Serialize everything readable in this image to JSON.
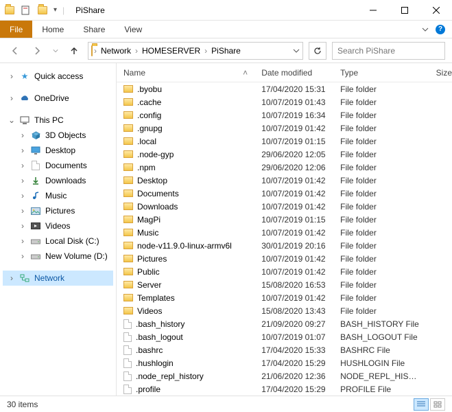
{
  "window": {
    "title": "PiShare"
  },
  "ribbon": {
    "file": "File",
    "home": "Home",
    "share": "Share",
    "view": "View"
  },
  "breadcrumb": {
    "segments": [
      "Network",
      "HOMESERVER",
      "PiShare"
    ]
  },
  "search": {
    "placeholder": "Search PiShare"
  },
  "tree": {
    "quick_access": "Quick access",
    "onedrive": "OneDrive",
    "this_pc": "This PC",
    "children": {
      "objects3d": "3D Objects",
      "desktop": "Desktop",
      "documents": "Documents",
      "downloads": "Downloads",
      "music": "Music",
      "pictures": "Pictures",
      "videos": "Videos",
      "localdisk": "Local Disk (C:)",
      "newvolume": "New Volume (D:)"
    },
    "network": "Network"
  },
  "columns": {
    "name": "Name",
    "date": "Date modified",
    "type": "Type",
    "size": "Size"
  },
  "items": [
    {
      "kind": "folder",
      "name": ".byobu",
      "date": "17/04/2020 15:31",
      "type": "File folder"
    },
    {
      "kind": "folder",
      "name": ".cache",
      "date": "10/07/2019 01:43",
      "type": "File folder"
    },
    {
      "kind": "folder",
      "name": ".config",
      "date": "10/07/2019 16:34",
      "type": "File folder"
    },
    {
      "kind": "folder",
      "name": ".gnupg",
      "date": "10/07/2019 01:42",
      "type": "File folder"
    },
    {
      "kind": "folder",
      "name": ".local",
      "date": "10/07/2019 01:15",
      "type": "File folder"
    },
    {
      "kind": "folder",
      "name": ".node-gyp",
      "date": "29/06/2020 12:05",
      "type": "File folder"
    },
    {
      "kind": "folder",
      "name": ".npm",
      "date": "29/06/2020 12:06",
      "type": "File folder"
    },
    {
      "kind": "folder",
      "name": "Desktop",
      "date": "10/07/2019 01:42",
      "type": "File folder"
    },
    {
      "kind": "folder",
      "name": "Documents",
      "date": "10/07/2019 01:42",
      "type": "File folder"
    },
    {
      "kind": "folder",
      "name": "Downloads",
      "date": "10/07/2019 01:42",
      "type": "File folder"
    },
    {
      "kind": "folder",
      "name": "MagPi",
      "date": "10/07/2019 01:15",
      "type": "File folder"
    },
    {
      "kind": "folder",
      "name": "Music",
      "date": "10/07/2019 01:42",
      "type": "File folder"
    },
    {
      "kind": "folder",
      "name": "node-v11.9.0-linux-armv6l",
      "date": "30/01/2019 20:16",
      "type": "File folder"
    },
    {
      "kind": "folder",
      "name": "Pictures",
      "date": "10/07/2019 01:42",
      "type": "File folder"
    },
    {
      "kind": "folder",
      "name": "Public",
      "date": "10/07/2019 01:42",
      "type": "File folder"
    },
    {
      "kind": "folder",
      "name": "Server",
      "date": "15/08/2020 16:53",
      "type": "File folder"
    },
    {
      "kind": "folder",
      "name": "Templates",
      "date": "10/07/2019 01:42",
      "type": "File folder"
    },
    {
      "kind": "folder",
      "name": "Videos",
      "date": "15/08/2020 13:43",
      "type": "File folder"
    },
    {
      "kind": "file",
      "name": ".bash_history",
      "date": "21/09/2020 09:27",
      "type": "BASH_HISTORY File"
    },
    {
      "kind": "file",
      "name": ".bash_logout",
      "date": "10/07/2019 01:07",
      "type": "BASH_LOGOUT File"
    },
    {
      "kind": "file",
      "name": ".bashrc",
      "date": "17/04/2020 15:33",
      "type": "BASHRC File"
    },
    {
      "kind": "file",
      "name": ".hushlogin",
      "date": "17/04/2020 15:29",
      "type": "HUSHLOGIN File"
    },
    {
      "kind": "file",
      "name": ".node_repl_history",
      "date": "21/06/2020 12:36",
      "type": "NODE_REPL_HIST..."
    },
    {
      "kind": "file",
      "name": ".profile",
      "date": "17/04/2020 15:29",
      "type": "PROFILE File"
    }
  ],
  "status": {
    "count": "30 items"
  }
}
